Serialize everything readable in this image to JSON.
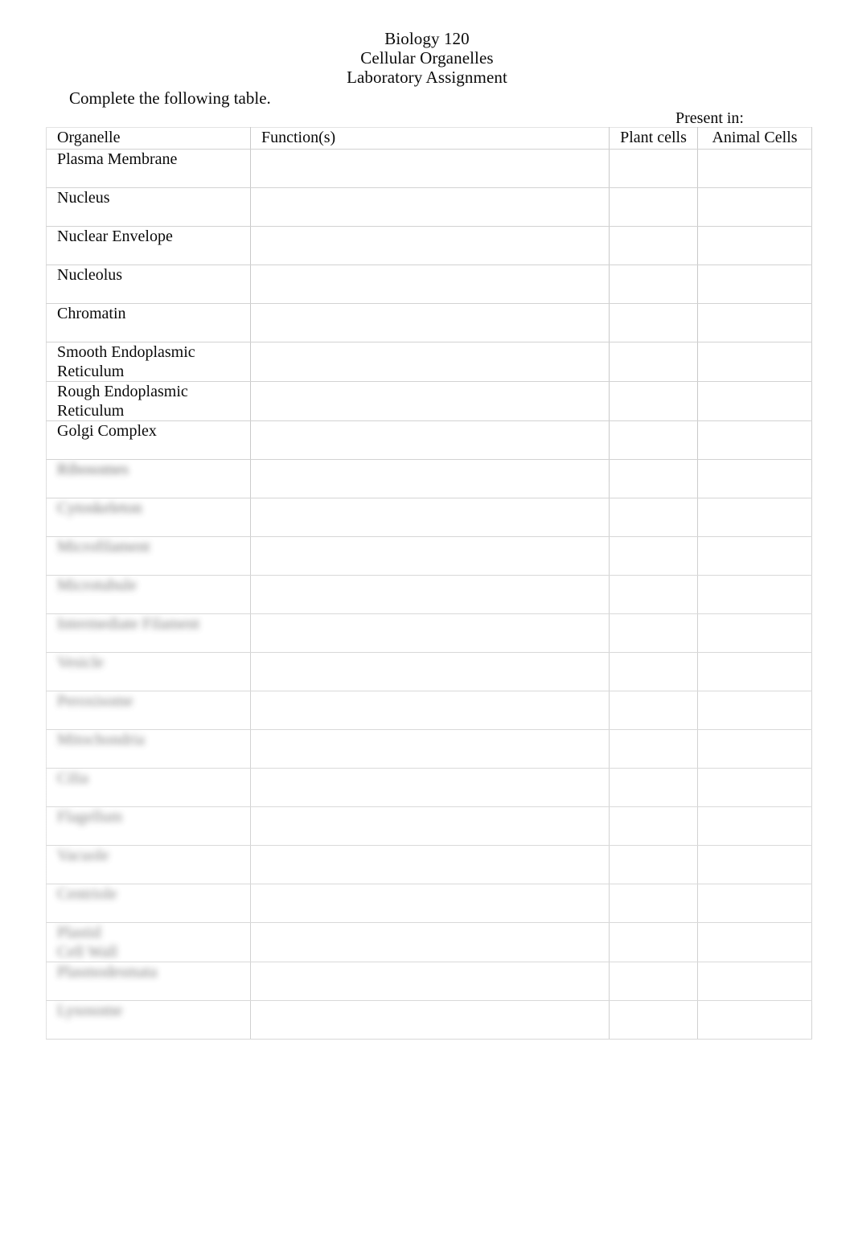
{
  "document": {
    "heading_lines": [
      "Biology 120",
      "Cellular Organelles",
      "Laboratory Assignment"
    ],
    "instruction": "Complete the following table."
  },
  "table": {
    "group_header": "Present in:",
    "columns": [
      {
        "key": "organelle",
        "label": "Organelle"
      },
      {
        "key": "function",
        "label": "Function(s)"
      },
      {
        "key": "plant",
        "label": "Plant cells"
      },
      {
        "key": "animal",
        "label": "Animal Cells"
      }
    ],
    "rows": [
      {
        "organelle": "Plasma Membrane",
        "function": "",
        "plant": "",
        "animal": "",
        "legible": true,
        "lines": 1
      },
      {
        "organelle": "Nucleus",
        "function": "",
        "plant": "",
        "animal": "",
        "legible": true,
        "lines": 1
      },
      {
        "organelle": "Nuclear Envelope",
        "function": "",
        "plant": "",
        "animal": "",
        "legible": true,
        "lines": 1
      },
      {
        "organelle": "Nucleolus",
        "function": "",
        "plant": "",
        "animal": "",
        "legible": true,
        "lines": 1
      },
      {
        "organelle": "Chromatin",
        "function": "",
        "plant": "",
        "animal": "",
        "legible": true,
        "lines": 1
      },
      {
        "organelle": "Smooth Endoplasmic\nReticulum",
        "function": "",
        "plant": "",
        "animal": "",
        "legible": true,
        "lines": 2
      },
      {
        "organelle": "Rough Endoplasmic\nReticulum",
        "function": "",
        "plant": "",
        "animal": "",
        "legible": true,
        "lines": 2
      },
      {
        "organelle": "Golgi Complex",
        "function": "",
        "plant": "",
        "animal": "",
        "legible": true,
        "lines": 1
      },
      {
        "organelle": "Ribosomes",
        "function": "",
        "plant": "",
        "animal": "",
        "legible": false,
        "lines": 1
      },
      {
        "organelle": "Cytoskeleton",
        "function": "",
        "plant": "",
        "animal": "",
        "legible": false,
        "lines": 1
      },
      {
        "organelle": "Microfilament",
        "function": "",
        "plant": "",
        "animal": "",
        "legible": false,
        "lines": 1
      },
      {
        "organelle": "Microtubule",
        "function": "",
        "plant": "",
        "animal": "",
        "legible": false,
        "lines": 1
      },
      {
        "organelle": "Intermediate Filament",
        "function": "",
        "plant": "",
        "animal": "",
        "legible": false,
        "lines": 1
      },
      {
        "organelle": "Vesicle",
        "function": "",
        "plant": "",
        "animal": "",
        "legible": false,
        "lines": 1
      },
      {
        "organelle": "Peroxisome",
        "function": "",
        "plant": "",
        "animal": "",
        "legible": false,
        "lines": 1
      },
      {
        "organelle": "Mitochondria",
        "function": "",
        "plant": "",
        "animal": "",
        "legible": false,
        "lines": 1
      },
      {
        "organelle": "Cilia",
        "function": "",
        "plant": "",
        "animal": "",
        "legible": false,
        "lines": 1
      },
      {
        "organelle": "Flagellum",
        "function": "",
        "plant": "",
        "animal": "",
        "legible": false,
        "lines": 1
      },
      {
        "organelle": "Vacuole",
        "function": "",
        "plant": "",
        "animal": "",
        "legible": false,
        "lines": 1
      },
      {
        "organelle": "Centriole",
        "function": "",
        "plant": "",
        "animal": "",
        "legible": false,
        "lines": 1
      },
      {
        "organelle": "Plastid\nCell Wall",
        "function": "",
        "plant": "",
        "animal": "",
        "legible": false,
        "lines": 2
      },
      {
        "organelle": "Plasmodesmata",
        "function": "",
        "plant": "",
        "animal": "",
        "legible": false,
        "lines": 1
      },
      {
        "organelle": "Lysosome",
        "function": "",
        "plant": "",
        "animal": "",
        "legible": false,
        "lines": 1
      }
    ]
  }
}
